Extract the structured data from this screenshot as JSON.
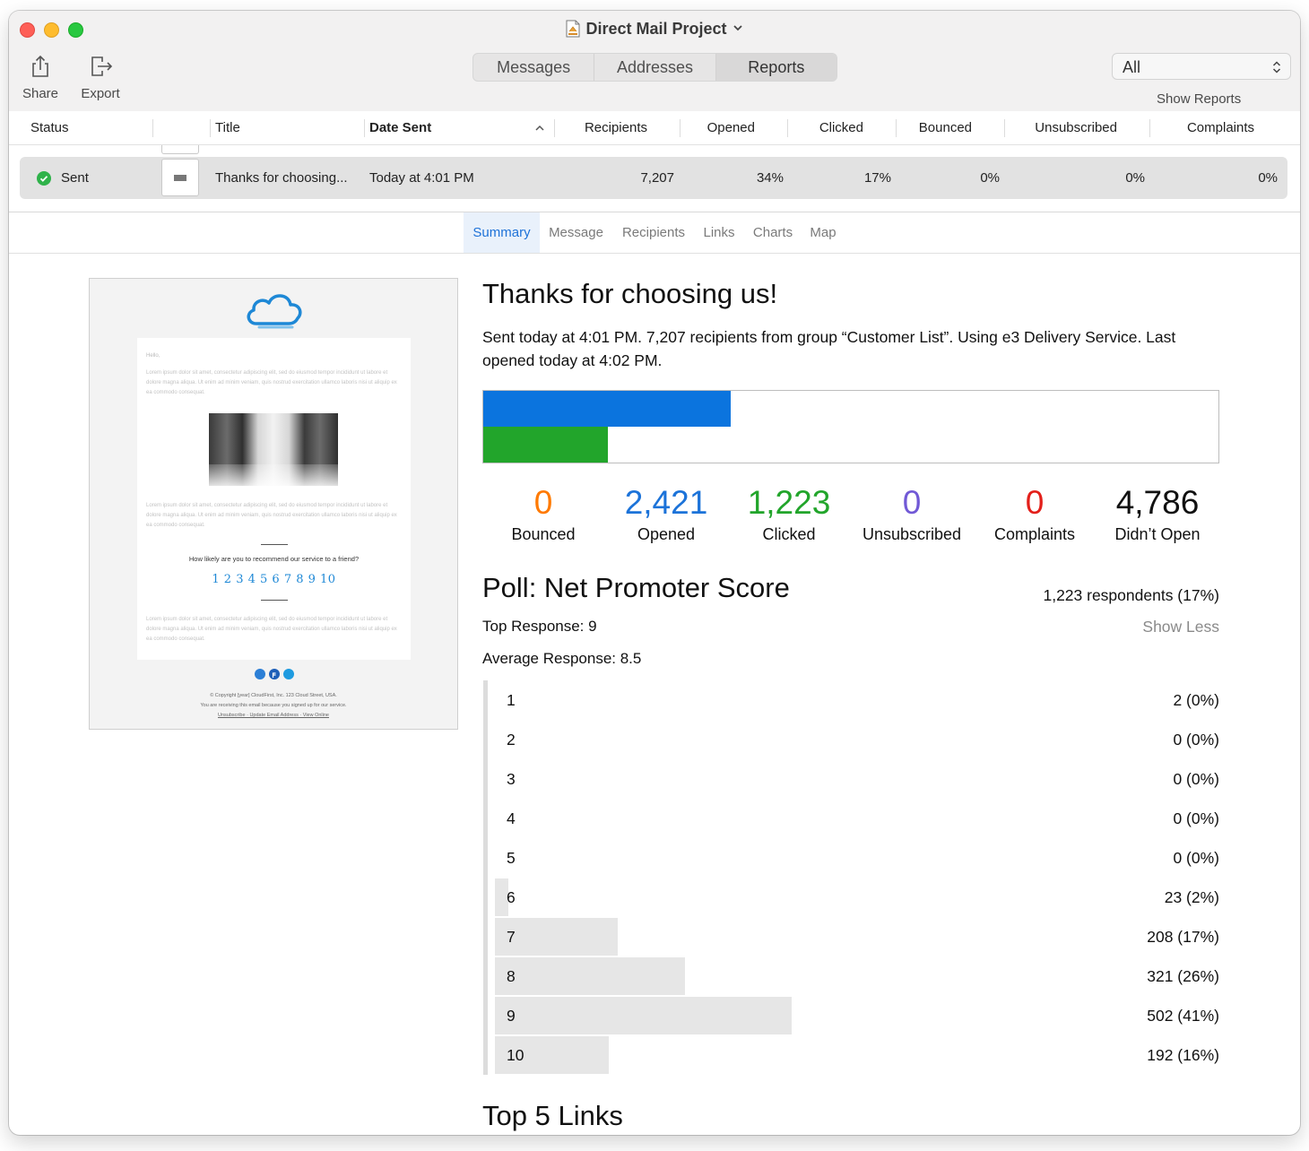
{
  "window": {
    "title": "Direct Mail Project"
  },
  "toolbar": {
    "share_label": "Share",
    "export_label": "Export",
    "tabs": [
      "Messages",
      "Addresses",
      "Reports"
    ],
    "active_tab": "Reports",
    "filter_value": "All",
    "show_reports_label": "Show Reports"
  },
  "table": {
    "columns": [
      "Status",
      "",
      "Title",
      "Date Sent",
      "Recipients",
      "Opened",
      "Clicked",
      "Bounced",
      "Unsubscribed",
      "Complaints"
    ],
    "sort_column": "Date Sent",
    "rows": [
      {
        "status": "Sent",
        "title": "Thanks for choosing...",
        "date_sent": "Today at 4:01 PM",
        "recipients": "7,207",
        "opened": "34%",
        "clicked": "17%",
        "bounced": "0%",
        "unsubscribed": "0%",
        "complaints": "0%"
      }
    ]
  },
  "detail_tabs": [
    "Summary",
    "Message",
    "Recipients",
    "Links",
    "Charts",
    "Map"
  ],
  "active_detail_tab": "Summary",
  "preview": {
    "hello": "Hello,",
    "lorem": [
      "Lorem ipsum dolor sit amet, consectetur adipiscing elit, sed do eiusmod tempor incididunt ut labore et dolore magna aliqua. Ut enim ad minim veniam, quis nostrud exercitation ullamco laboris nisi ut aliquip ex ea commodo consequat.",
      "Lorem ipsum dolor sit amet, consectetur adipiscing elit, sed do eiusmod tempor incididunt ut labore et dolore magna aliqua. Ut enim ad minim veniam, quis nostrud exercitation ullamco laboris nisi ut aliquip ex ea commodo consequat.",
      "Lorem ipsum dolor sit amet, consectetur adipiscing elit, sed do eiusmod tempor incididunt ut labore et dolore magna aliqua. Ut enim ad minim veniam, quis nostrud exercitation ullamco laboris nisi ut aliquip ex ea commodo consequat."
    ],
    "question": "How likely are you to recommend our service to a friend?",
    "scale": "1 2 3 4 5 6 7 8 9 10",
    "footer_line1": "© Copyright [year] CloudFirst, Inc. 123 Cloud Street, USA.",
    "footer_line2": "You are receiving this email because you signed up for our service.",
    "footer_links": "Unsubscribe · Update Email Address · View Online"
  },
  "summary": {
    "title": "Thanks for choosing us!",
    "description": "Sent today at 4:01 PM. 7,207 recipients from group “Customer List”. Using e3 Delivery Service. Last opened today at 4:02 PM.",
    "opened_fraction": 0.336,
    "clicked_fraction": 0.17,
    "stats": [
      {
        "value": "0",
        "label": "Bounced",
        "color": "#ff7a00"
      },
      {
        "value": "2,421",
        "label": "Opened",
        "color": "#1c73d9"
      },
      {
        "value": "1,223",
        "label": "Clicked",
        "color": "#22a52b"
      },
      {
        "value": "0",
        "label": "Unsubscribed",
        "color": "#7159d6"
      },
      {
        "value": "0",
        "label": "Complaints",
        "color": "#e3201b"
      },
      {
        "value": "4,786",
        "label": "Didn’t Open",
        "color": "#111111"
      }
    ],
    "bar_colors": {
      "opened": "#0b74de",
      "clicked": "#22a52b"
    }
  },
  "poll": {
    "title": "Poll: Net Promoter Score",
    "respondents": "1,223 respondents (17%)",
    "top_response": "Top Response: 9",
    "average_response": "Average Response: 8.5",
    "show_less_label": "Show Less",
    "responses": [
      {
        "label": "1",
        "value": "2 (0%)",
        "fraction": 0.0
      },
      {
        "label": "2",
        "value": "0 (0%)",
        "fraction": 0.0
      },
      {
        "label": "3",
        "value": "0 (0%)",
        "fraction": 0.0
      },
      {
        "label": "4",
        "value": "0 (0%)",
        "fraction": 0.0
      },
      {
        "label": "5",
        "value": "0 (0%)",
        "fraction": 0.0
      },
      {
        "label": "6",
        "value": "23 (2%)",
        "fraction": 0.019
      },
      {
        "label": "7",
        "value": "208 (17%)",
        "fraction": 0.17
      },
      {
        "label": "8",
        "value": "321 (26%)",
        "fraction": 0.262
      },
      {
        "label": "9",
        "value": "502 (41%)",
        "fraction": 0.41
      },
      {
        "label": "10",
        "value": "192 (16%)",
        "fraction": 0.157
      }
    ]
  },
  "links_section": {
    "title": "Top 5 Links"
  }
}
